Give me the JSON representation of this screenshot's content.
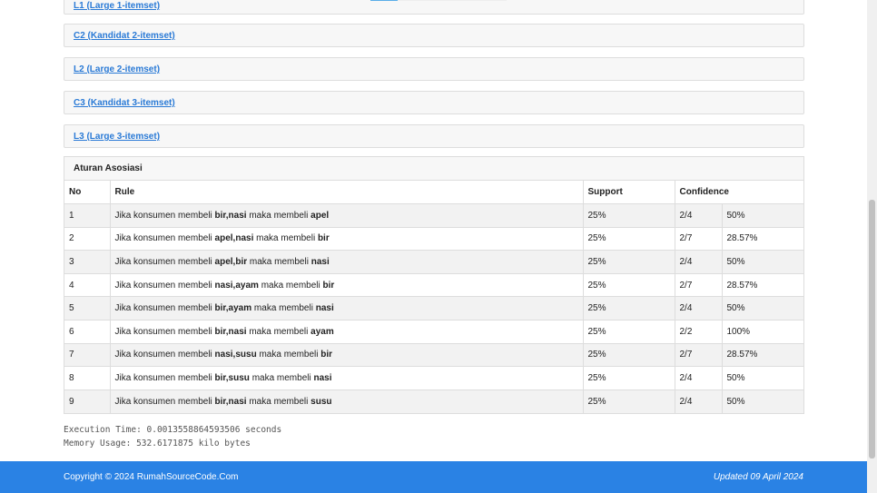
{
  "panels": [
    {
      "label": "L1 (Large 1-itemset)"
    },
    {
      "label": "C2 (Kandidat 2-itemset)"
    },
    {
      "label": "L2 (Large 2-itemset)"
    },
    {
      "label": "C3 (Kandidat 3-itemset)"
    },
    {
      "label": "L3 (Large 3-itemset)"
    }
  ],
  "rules": {
    "title": "Aturan Asosiasi",
    "headers": [
      "No",
      "Rule",
      "Support",
      "Confidence"
    ],
    "prefix": "Jika konsumen membeli",
    "middle": "maka membeli",
    "rows": [
      {
        "no": "1",
        "if": "bir,nasi",
        "then": "apel",
        "support": "25%",
        "ratio": "2/4",
        "conf": "50%"
      },
      {
        "no": "2",
        "if": "apel,nasi",
        "then": "bir",
        "support": "25%",
        "ratio": "2/7",
        "conf": "28.57%"
      },
      {
        "no": "3",
        "if": "apel,bir",
        "then": "nasi",
        "support": "25%",
        "ratio": "2/4",
        "conf": "50%"
      },
      {
        "no": "4",
        "if": "nasi,ayam",
        "then": "bir",
        "support": "25%",
        "ratio": "2/7",
        "conf": "28.57%"
      },
      {
        "no": "5",
        "if": "bir,ayam",
        "then": "nasi",
        "support": "25%",
        "ratio": "2/4",
        "conf": "50%"
      },
      {
        "no": "6",
        "if": "bir,nasi",
        "then": "ayam",
        "support": "25%",
        "ratio": "2/2",
        "conf": "100%"
      },
      {
        "no": "7",
        "if": "nasi,susu",
        "then": "bir",
        "support": "25%",
        "ratio": "2/7",
        "conf": "28.57%"
      },
      {
        "no": "8",
        "if": "bir,susu",
        "then": "nasi",
        "support": "25%",
        "ratio": "2/4",
        "conf": "50%"
      },
      {
        "no": "9",
        "if": "bir,nasi",
        "then": "susu",
        "support": "25%",
        "ratio": "2/4",
        "conf": "50%"
      }
    ]
  },
  "stats": {
    "exec": "Execution Time: 0.0013558864593506 seconds",
    "mem": "Memory Usage: 532.6171875 kilo bytes"
  },
  "footer": {
    "copyright": "Copyright © 2024 RumahSourceCode.Com",
    "updated": "Updated 09 April 2024",
    "color": "#2a82e4"
  }
}
